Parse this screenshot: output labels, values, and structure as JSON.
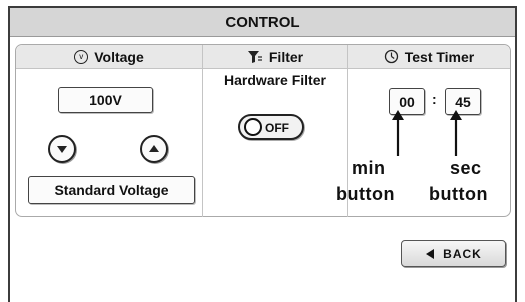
{
  "header": {
    "title": "CONTROL"
  },
  "voltage": {
    "title": "Voltage",
    "icon": "voltage-icon",
    "value": "100V",
    "down_icon": "arrow-down-icon",
    "up_icon": "arrow-up-icon",
    "standard_label": "Standard Voltage"
  },
  "filter": {
    "title": "Filter",
    "icon": "filter-icon",
    "hardware_label": "Hardware Filter",
    "toggle_state": "OFF"
  },
  "timer": {
    "title": "Test Timer",
    "icon": "clock-icon",
    "minutes": "00",
    "separator": ":",
    "seconds": "45"
  },
  "annotations": {
    "min_line1": "min",
    "min_line2": "button",
    "sec_line1": "sec",
    "sec_line2": "button"
  },
  "footer": {
    "back_label": "BACK",
    "back_icon": "triangle-left-icon"
  }
}
